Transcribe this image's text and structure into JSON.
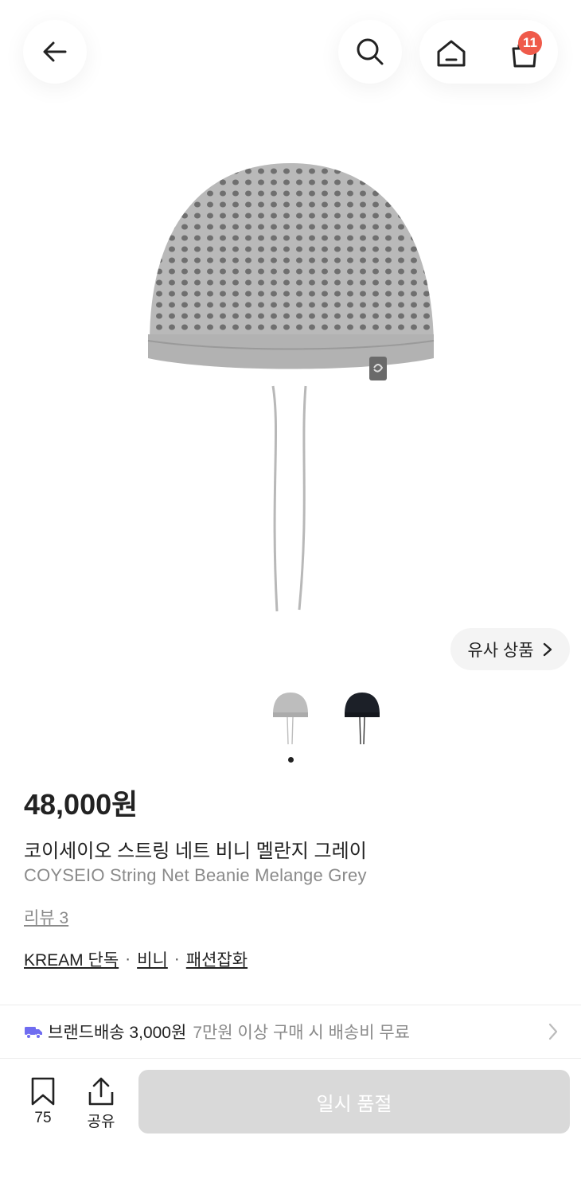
{
  "header": {
    "back_icon": "arrow-left-icon",
    "search_icon": "search-icon",
    "home_icon": "home-icon",
    "cart_icon": "shopping-bag-icon",
    "cart_count": "11"
  },
  "gallery": {
    "similar_label": "유사 상품",
    "thumbnails": [
      "grey beanie",
      "black beanie"
    ],
    "active_index": 1
  },
  "product": {
    "price": "48,000원",
    "name_ko": "코이세이오 스트링 네트 비니 멜란지 그레이",
    "name_en": "COYSEIO String Net Beanie Melange Grey",
    "review": "리뷰 3",
    "tags": [
      "KREAM 단독",
      "비니",
      "패션잡화"
    ],
    "tag_separator": "·"
  },
  "shipping": {
    "label": "브랜드배송 3,000원",
    "note": "7만원 이상 구매 시 배송비 무료",
    "icon": "truck-icon",
    "icon_color": "#6f6cf0"
  },
  "bottom": {
    "bookmark_count": "75",
    "share_label": "공유",
    "soldout_label": "일시 품절"
  },
  "colors": {
    "badge": "#ef5a4a",
    "soldout_bg": "#d9d9d9"
  }
}
